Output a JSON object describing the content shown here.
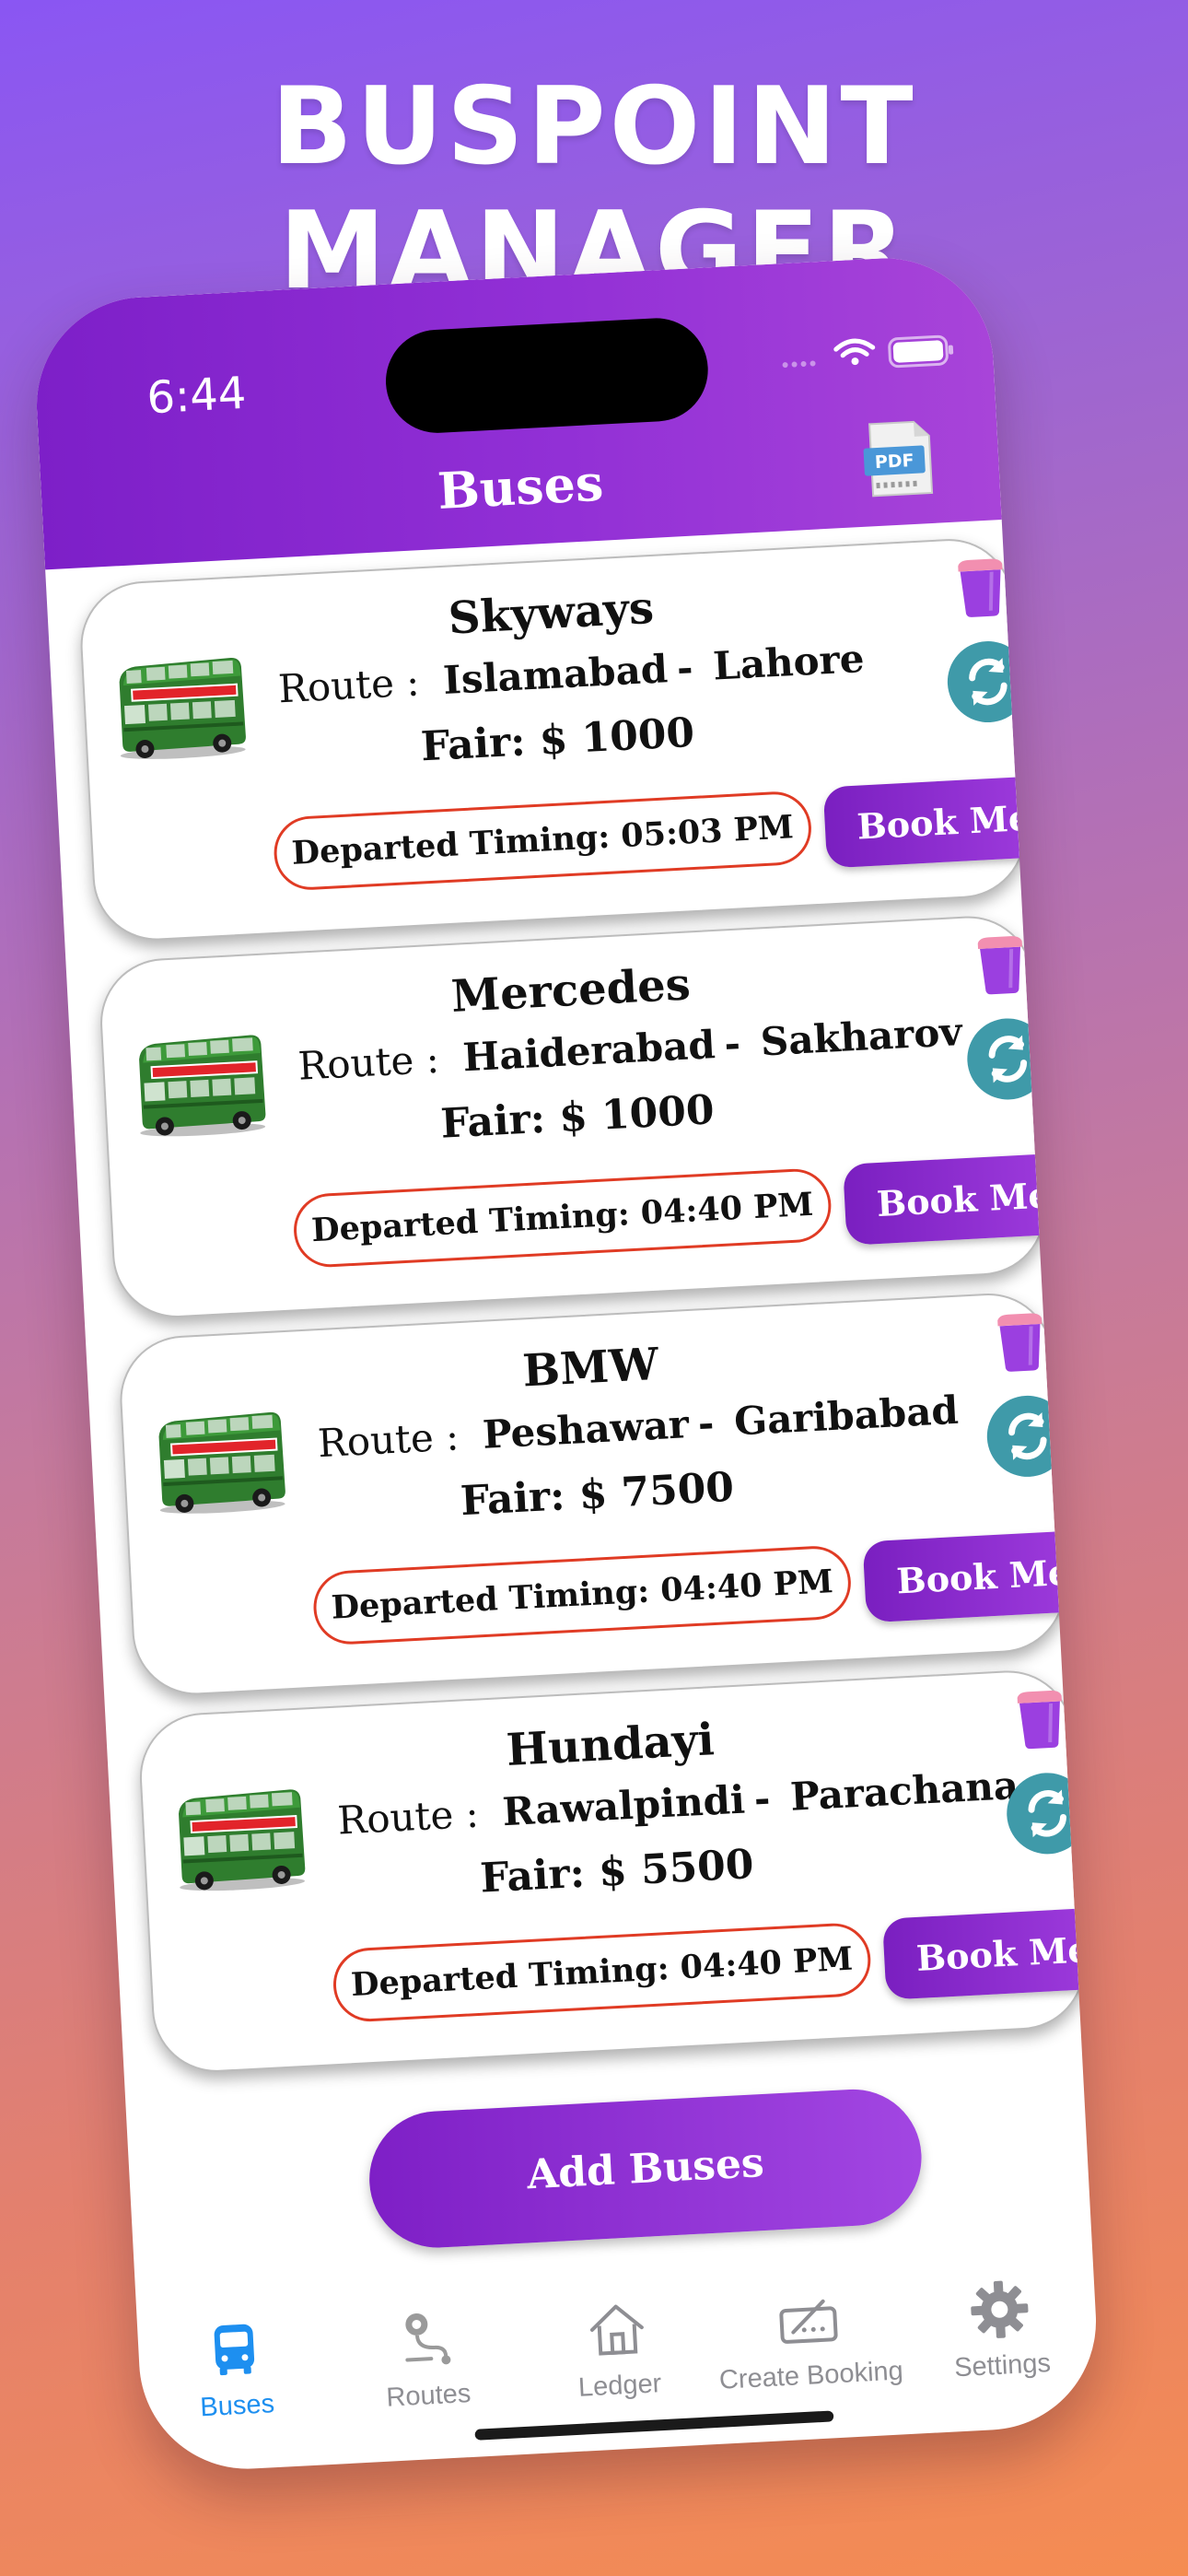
{
  "headline": "BUSPOINT MANAGER",
  "status_bar": {
    "time": "6:44"
  },
  "nav": {
    "title": "Buses",
    "pdf_label": "PDF"
  },
  "route_label": "Route :",
  "buses": [
    {
      "name": "Skyways",
      "from": "Islamabad",
      "to": "Lahore",
      "fare": "Fair: $ 1000",
      "departed": "Departed Timing: 05:03 PM",
      "book_label": "Book Me"
    },
    {
      "name": "Mercedes",
      "from": "Haiderabad",
      "to": "Sakharov",
      "fare": "Fair: $ 1000",
      "departed": "Departed Timing: 04:40 PM",
      "book_label": "Book Me"
    },
    {
      "name": "BMW",
      "from": "Peshawar",
      "to": "Garibabad",
      "fare": "Fair: $ 7500",
      "departed": "Departed Timing: 04:40 PM",
      "book_label": "Book Me"
    },
    {
      "name": "Hundayi",
      "from": "Rawalpindi",
      "to": "Parachana",
      "fare": "Fair: $ 5500",
      "departed": "Departed Timing: 04:40 PM",
      "book_label": "Book Me"
    }
  ],
  "add_button": "Add Buses",
  "tabs": [
    {
      "label": "Buses",
      "icon": "bus-icon",
      "active": true
    },
    {
      "label": "Routes",
      "icon": "route-icon",
      "active": false
    },
    {
      "label": "Ledger",
      "icon": "house-icon",
      "active": false
    },
    {
      "label": "Create Booking",
      "icon": "ticket-icon",
      "active": false
    },
    {
      "label": "Settings",
      "icon": "gear-icon",
      "active": false
    }
  ],
  "colors": {
    "accent": "#8a2bd3",
    "active_tab": "#1d8ff0",
    "sync": "#3f9aa9",
    "departed_border": "#e03b24"
  }
}
